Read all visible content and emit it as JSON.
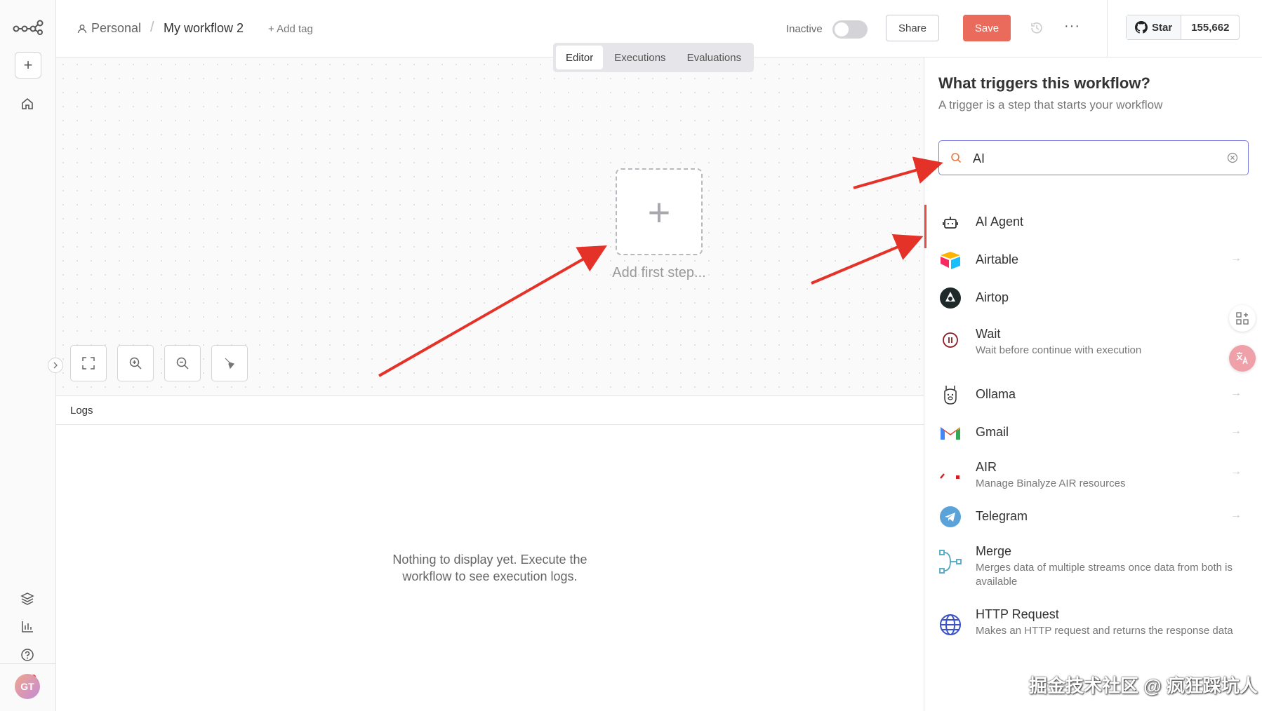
{
  "header": {
    "crumb_personal": "Personal",
    "crumb_sep": "/",
    "workflow_name": "My workflow 2",
    "add_tag": "+ Add tag",
    "inactive_label": "Inactive",
    "share_label": "Share",
    "save_label": "Save",
    "more_label": "···",
    "github_star_label": "Star",
    "github_star_count": "155,662"
  },
  "tabs": [
    {
      "label": "Editor",
      "active": true
    },
    {
      "label": "Executions",
      "active": false
    },
    {
      "label": "Evaluations",
      "active": false
    }
  ],
  "canvas": {
    "add_step_label": "Add first step..."
  },
  "logs": {
    "title": "Logs",
    "empty_line1": "Nothing to display yet. Execute the",
    "empty_line2": "workflow to see execution logs."
  },
  "sidebar": {
    "avatar_initials": "GT"
  },
  "panel": {
    "title": "What triggers this workflow?",
    "subtitle": "A trigger is a step that starts your workflow",
    "search_value": "AI",
    "nodes": [
      {
        "name": "AI Agent",
        "desc": "",
        "icon": "robot-icon"
      },
      {
        "name": "Airtable",
        "desc": "",
        "icon": "airtable-icon"
      },
      {
        "name": "Airtop",
        "desc": "",
        "icon": "airtop-icon"
      },
      {
        "name": "Wait",
        "desc": "Wait before continue with execution",
        "icon": "pause-icon"
      },
      {
        "name": "Ollama",
        "desc": "",
        "icon": "llama-icon"
      },
      {
        "name": "Gmail",
        "desc": "",
        "icon": "gmail-icon"
      },
      {
        "name": "AIR",
        "desc": "Manage Binalyze AIR resources",
        "icon": "air-icon"
      },
      {
        "name": "Telegram",
        "desc": "",
        "icon": "telegram-icon"
      },
      {
        "name": "Merge",
        "desc": "Merges data of multiple streams once data from both is available",
        "icon": "merge-icon"
      },
      {
        "name": "HTTP Request",
        "desc": "Makes an HTTP request and returns the response data",
        "icon": "globe-icon"
      }
    ]
  },
  "watermark": "掘金技术社区 @ 疯狂踩坑人",
  "colors": {
    "accent": "#ea4b40",
    "save": "#ea6a5b",
    "search_border": "#7c7cdc"
  }
}
